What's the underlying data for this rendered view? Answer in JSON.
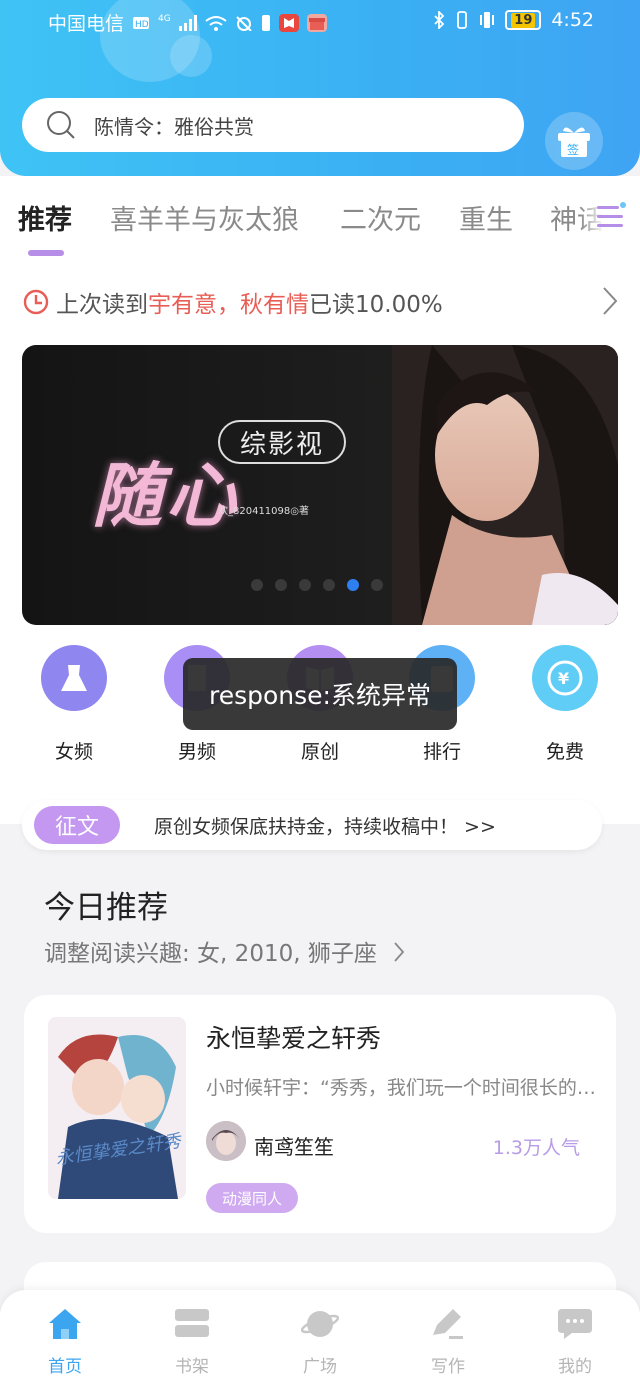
{
  "status_bar": {
    "carrier": "中国电信",
    "network": "4G",
    "battery": "19",
    "time": "4:52"
  },
  "search": {
    "placeholder": "陈情令：雅俗共赏",
    "checkin_label": "签"
  },
  "tabs": [
    {
      "label": "推荐",
      "active": true
    },
    {
      "label": "喜羊羊与灰太狼",
      "active": false
    },
    {
      "label": "二次元",
      "active": false
    },
    {
      "label": "重生",
      "active": false
    },
    {
      "label": "神话",
      "active": false
    }
  ],
  "recent_read": {
    "prefix": "上次读到",
    "book": "宇有意，秋有情",
    "suffix": "已读10.00%"
  },
  "banner": {
    "tag": "综影视",
    "title": "随心",
    "author": "欢_820411098◎著",
    "slide_count": 6,
    "active_slide": 4
  },
  "categories": [
    {
      "label": "女频",
      "icon": "dress-icon",
      "color": "#8f86f0"
    },
    {
      "label": "男频",
      "icon": "shirt-icon",
      "color": "#a88ef5"
    },
    {
      "label": "原创",
      "icon": "book-icon",
      "color": "#b58ef2"
    },
    {
      "label": "排行",
      "icon": "ranking-icon",
      "color": "#5fb1f5"
    },
    {
      "label": "免费",
      "icon": "coin-icon",
      "color": "#5fcdf5"
    }
  ],
  "toast": "response:系统异常",
  "contest": {
    "tag": "征文",
    "text": "原创女频保底扶持金，持续收稿中！ >>"
  },
  "today": {
    "title": "今日推荐",
    "interest": "调整阅读兴趣: 女, 2010, 狮子座"
  },
  "book": {
    "title": "永恒挚爱之轩秀",
    "description": "小时候轩宇：“秀秀，我们玩一个时间很长的游戏好不好？",
    "author": "南鸢笙笙",
    "popularity": "1.3万人气",
    "tag": "动漫同人",
    "cover_text": "永恒挚爱之轩秀"
  },
  "bottom_nav": [
    {
      "label": "首页",
      "icon": "home-icon",
      "active": true
    },
    {
      "label": "书架",
      "icon": "bookshelf-icon",
      "active": false
    },
    {
      "label": "广场",
      "icon": "planet-icon",
      "active": false
    },
    {
      "label": "写作",
      "icon": "pen-icon",
      "active": false
    },
    {
      "label": "我的",
      "icon": "chat-icon",
      "active": false
    }
  ],
  "colors": {
    "header": "#3ab0f3",
    "accent_purple": "#b68ee8",
    "highlight_red": "#e85d55",
    "nav_active": "#3ba5f0"
  }
}
